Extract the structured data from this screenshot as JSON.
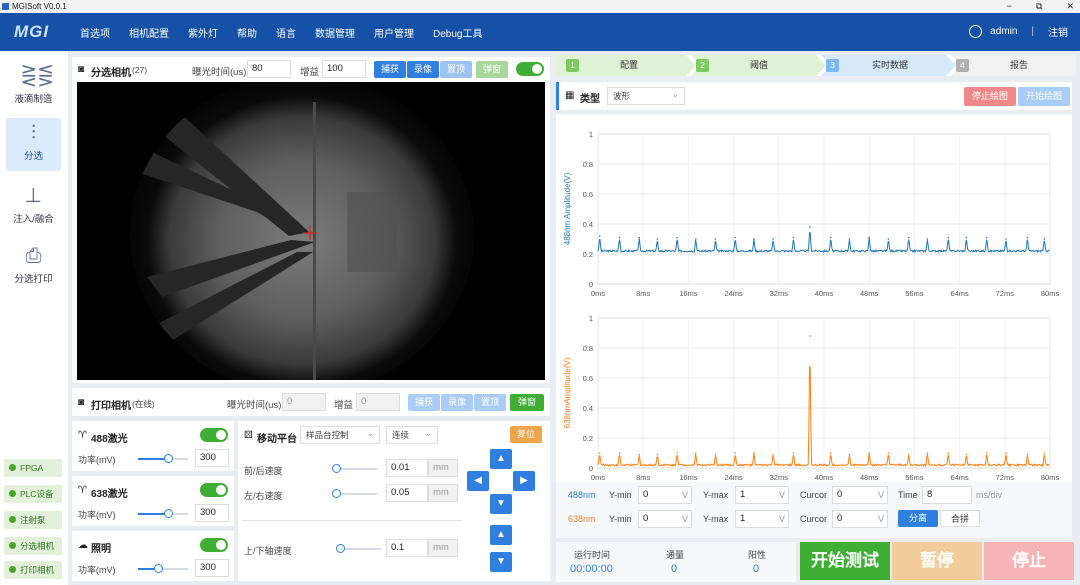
{
  "window": {
    "title": "MGISoft V0.0.1",
    "min": "−",
    "restore": "⧉",
    "close": "✕"
  },
  "menubar": {
    "logo": "MGI",
    "items": [
      "首选项",
      "相机配置",
      "紫外灯",
      "帮助",
      "语言",
      "数据管理",
      "用户管理",
      "Debug工具"
    ],
    "user": "admin",
    "logout": "注销",
    "sep": "|"
  },
  "sidebar": {
    "items": [
      {
        "label": "液滴制造",
        "icon": "droplet-chip-icon"
      },
      {
        "label": "分选",
        "icon": "sorting-icon"
      },
      {
        "label": "注入/融合",
        "icon": "injection-icon"
      },
      {
        "label": "分选打印",
        "icon": "printer-icon"
      }
    ],
    "active": 1,
    "status": [
      "FPGA",
      "PLC设备",
      "注射泵",
      "分选相机",
      "打印相机"
    ]
  },
  "sort_camera": {
    "title": "分选相机",
    "count": "(27)",
    "exposure_label": "曝光时间(us)",
    "exposure": "80",
    "gain_label": "增益",
    "gain": "100",
    "btn_capture": "捕获",
    "btn_record": "录像",
    "btn_top": "置顶",
    "btn_popup": "弹窗"
  },
  "print_camera": {
    "title": "打印相机",
    "state": "(在线)",
    "exposure_label": "曝光时间(us)",
    "exposure": "0",
    "gain_label": "增益",
    "gain": "0",
    "btn_capture": "捕获",
    "btn_record": "录像",
    "btn_top": "置顶",
    "btn_popup": "弹窗"
  },
  "lasers": [
    {
      "name": "488激光",
      "power_label": "功率(mV)",
      "power": "300",
      "level": 0.6
    },
    {
      "name": "638激光",
      "power_label": "功率(mV)",
      "power": "300",
      "level": 0.6
    },
    {
      "name": "照明",
      "power_label": "功率(mV)",
      "power": "300",
      "level": 0.4
    }
  ],
  "stage": {
    "title": "移动平台",
    "mode": "样品台控制",
    "move": "连续",
    "reset": "复位",
    "speeds": [
      {
        "label": "前/后速度",
        "value": "0.01",
        "unit": "mm"
      },
      {
        "label": "左/右速度",
        "value": "0.05",
        "unit": "mm"
      },
      {
        "label": "上/下轴速度",
        "value": "0.1",
        "unit": "mm"
      }
    ]
  },
  "steps": [
    {
      "n": "1",
      "label": "配置"
    },
    {
      "n": "2",
      "label": "阈值"
    },
    {
      "n": "3",
      "label": "实时数据"
    },
    {
      "n": "4",
      "label": "报告"
    }
  ],
  "plot": {
    "type_label": "类型",
    "type_value": "波形",
    "stop": "停止绘图",
    "start": "开始绘图"
  },
  "chart_data": [
    {
      "type": "line",
      "ylabel": "488nm Amplitude(V)",
      "ylim": [
        0,
        1
      ],
      "yticks": [
        "0",
        "0.2",
        "0.4",
        "0.6",
        "0.8",
        "1"
      ],
      "xticks": [
        "0ms",
        "8ms",
        "16ms",
        "24ms",
        "32ms",
        "40ms",
        "48ms",
        "56ms",
        "64ms",
        "72ms",
        "80ms"
      ],
      "xlim": [
        0,
        80
      ],
      "baseline": 0.22,
      "peaks_x": [
        0.3,
        3.8,
        7.3,
        10.5,
        14,
        17.3,
        20.8,
        24.3,
        27.6,
        31,
        34.6,
        37.5,
        41.2,
        44.5,
        48,
        51.4,
        55,
        58.3,
        62,
        65.2,
        68.8,
        72.2,
        76,
        79
      ],
      "peaks_y": [
        0.32,
        0.31,
        0.31,
        0.3,
        0.31,
        0.3,
        0.3,
        0.31,
        0.3,
        0.3,
        0.31,
        0.38,
        0.31,
        0.3,
        0.31,
        0.3,
        0.31,
        0.3,
        0.31,
        0.31,
        0.31,
        0.3,
        0.31,
        0.3
      ],
      "color": "#1f77b4"
    },
    {
      "type": "line",
      "ylabel": "638nmAmplitude(V)",
      "ylim": [
        0,
        1
      ],
      "yticks": [
        "0",
        "0.2",
        "0.4",
        "0.6",
        "0.8",
        "1"
      ],
      "xticks": [
        "0ms",
        "8ms",
        "16ms",
        "24ms",
        "32ms",
        "40ms",
        "48ms",
        "56ms",
        "64ms",
        "72ms",
        "80ms"
      ],
      "xlim": [
        0,
        80
      ],
      "baseline": 0.02,
      "peaks_x": [
        0.3,
        3.8,
        7.3,
        10.5,
        14,
        17.3,
        20.8,
        24.3,
        27.6,
        31,
        34.6,
        37.5,
        41.2,
        44.5,
        48,
        51.4,
        55,
        58.3,
        62,
        65.2,
        68.8,
        72.2,
        76,
        79
      ],
      "peaks_y": [
        0.1,
        0.1,
        0.09,
        0.09,
        0.1,
        0.1,
        0.09,
        0.1,
        0.1,
        0.09,
        0.1,
        0.88,
        0.1,
        0.09,
        0.1,
        0.1,
        0.09,
        0.1,
        0.1,
        0.09,
        0.1,
        0.1,
        0.09,
        0.1
      ],
      "color": "#ff7f0e"
    }
  ],
  "axes_ctrl": {
    "ch1": "488nm",
    "ch2": "638nm",
    "ymin_label": "Y-min",
    "ymin": "0",
    "ymax_label": "Y-max",
    "ymax": "1",
    "cursor_label": "Curcor",
    "cursor": "0",
    "unit": "V",
    "time_label": "Time",
    "time": "8",
    "time_unit": "ms/div",
    "split": "分离",
    "merge": "合拼"
  },
  "stats": {
    "runtime_label": "运行时间",
    "runtime": "00:00:00",
    "flux_label": "通量",
    "flux": "0",
    "positive_label": "阳性",
    "positive": "0"
  },
  "actions": {
    "start": "开始测试",
    "pause": "暂停",
    "stop": "停止"
  },
  "colors": {
    "primary": "#1552a7",
    "blue": "#2f7fe0",
    "green": "#3fae34",
    "orange": "#f0a54a",
    "red": "#f08a8a"
  }
}
